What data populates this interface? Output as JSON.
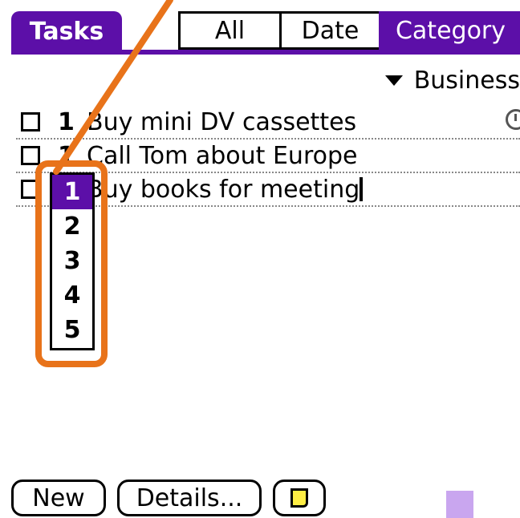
{
  "header": {
    "title": "Tasks",
    "tabs": [
      {
        "label": "All",
        "selected": false
      },
      {
        "label": "Date",
        "selected": false
      },
      {
        "label": "Category",
        "selected": true
      }
    ]
  },
  "category_select": {
    "value": "Business"
  },
  "tasks": [
    {
      "priority": "1",
      "description": "Buy mini DV cassettes",
      "checked": false,
      "has_alarm": true
    },
    {
      "priority": "1",
      "description": "Call Tom about Europe",
      "checked": false,
      "has_alarm": false
    },
    {
      "priority": "1",
      "description": "Buy books for meeting",
      "checked": false,
      "has_alarm": false,
      "editing": true
    }
  ],
  "priority_popup": {
    "options": [
      "1",
      "2",
      "3",
      "4",
      "5"
    ],
    "selected": "1"
  },
  "buttons": {
    "new": "New",
    "details": "Details..."
  },
  "colors": {
    "accent": "#5c0fa8",
    "callout": "#e8731a",
    "note": "#ffee44",
    "graffiti": "#c9a6ef"
  },
  "icons": {
    "alarm": "alarm-clock-icon",
    "note": "note-icon",
    "dropdown": "triangle-down-icon"
  }
}
